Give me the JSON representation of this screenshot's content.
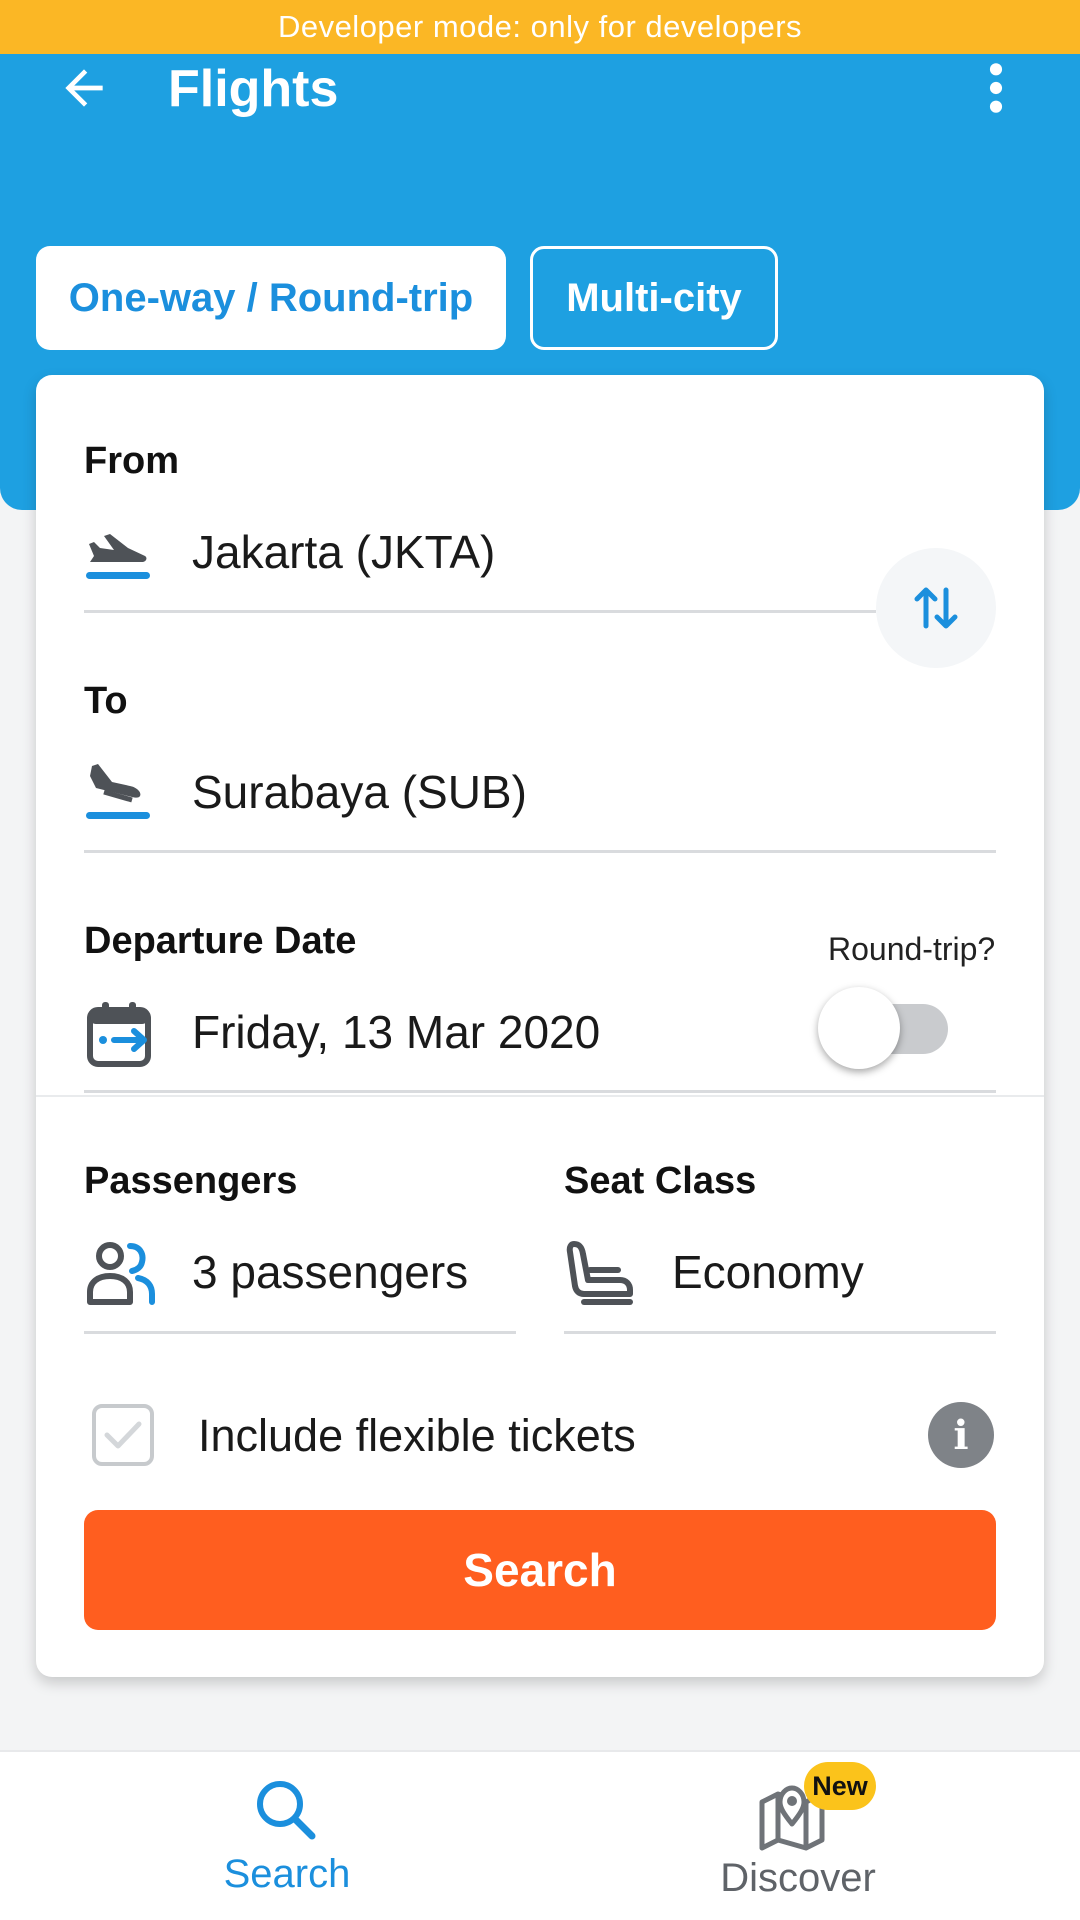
{
  "banner": {
    "text": "Developer mode: only for developers"
  },
  "appbar": {
    "title": "Flights",
    "back_icon": "arrow-left-icon",
    "menu_icon": "more-vertical-icon"
  },
  "tabs": [
    {
      "label": "One-way / Round-trip",
      "selected": true
    },
    {
      "label": "Multi-city",
      "selected": false
    }
  ],
  "form": {
    "from": {
      "label": "From",
      "value": "Jakarta (JKTA)",
      "icon": "plane-takeoff-icon"
    },
    "to": {
      "label": "To",
      "value": "Surabaya (SUB)",
      "icon": "plane-landing-icon"
    },
    "swap_icon": "swap-vertical-icon",
    "departure": {
      "label": "Departure Date",
      "value": "Friday, 13 Mar 2020",
      "icon": "calendar-icon"
    },
    "round_trip": {
      "label": "Round-trip?",
      "enabled": false
    },
    "passengers": {
      "label": "Passengers",
      "value": "3 passengers",
      "icon": "people-icon"
    },
    "seat_class": {
      "label": "Seat Class",
      "value": "Economy",
      "icon": "seat-icon"
    },
    "flexible": {
      "label": "Include flexible tickets",
      "checked": false
    },
    "search_label": "Search"
  },
  "bottom_nav": [
    {
      "label": "Search",
      "icon": "search-icon",
      "active": true
    },
    {
      "label": "Discover",
      "icon": "map-pin-icon",
      "active": false,
      "badge": "New"
    }
  ],
  "colors": {
    "header": "#1ea0e1",
    "banner": "#fbb725",
    "primary_text": "#1b8fdd",
    "search_button": "#ff5e1f",
    "badge": "#fbc31b"
  }
}
